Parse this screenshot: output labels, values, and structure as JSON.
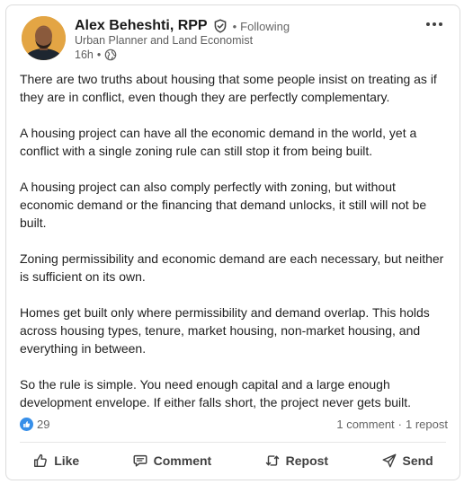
{
  "author": {
    "name": "Alex Beheshti, RPP",
    "relationship": "Following",
    "separator": "•",
    "headline": "Urban Planner and Land Economist",
    "time": "16h",
    "visibility_icon": "globe-icon"
  },
  "post": {
    "paragraphs": [
      "There are two truths about housing that some people insist on treating as if they are in conflict, even though they are perfectly complementary.",
      "A housing project can have all the economic demand in the world, yet a conflict with a single zoning rule can still stop it from being built.",
      "A housing project can also comply perfectly with zoning, but without economic demand or the financing that demand unlocks, it still will not be built.",
      "Zoning permissibility and economic demand are each necessary, but neither is sufficient on its own.",
      "Homes get built only where permissibility and demand overlap. This holds across housing types, tenure, market housing, non-market housing, and everything in between.",
      "So the rule is simple. You need enough capital and a large enough development envelope. If either falls short, the project never gets built."
    ]
  },
  "social": {
    "reaction_count": "29",
    "comments": "1 comment",
    "dot": "·",
    "reposts": "1 repost"
  },
  "actions": {
    "like": "Like",
    "comment": "Comment",
    "repost": "Repost",
    "send": "Send"
  },
  "colors": {
    "like_blue": "#378fe9",
    "avatar_bg": "#e0a542"
  }
}
